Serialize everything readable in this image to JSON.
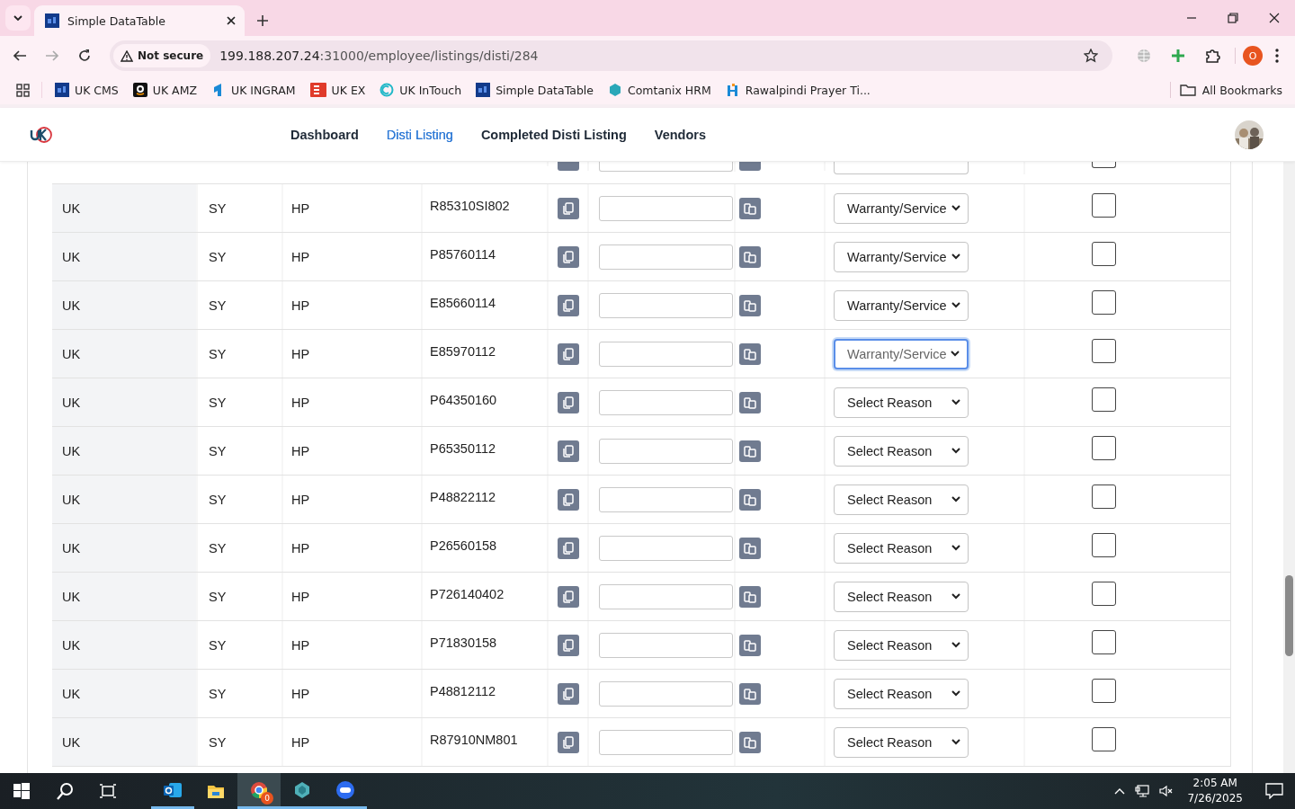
{
  "browser": {
    "tabs": [
      {
        "title": "Simple DataTable",
        "selected": true
      }
    ],
    "address": {
      "security": "Not secure",
      "host": "199.188.207.24",
      "path": ":31000/employee/listings/disti/284"
    },
    "bookmarks": [
      {
        "label": "UK CMS",
        "kind": "df"
      },
      {
        "label": "UK AMZ",
        "kind": "amz"
      },
      {
        "label": "UK INGRAM",
        "kind": "ingram"
      },
      {
        "label": "UK EX",
        "kind": "ex"
      },
      {
        "label": "UK InTouch",
        "kind": "intouch"
      },
      {
        "label": "Simple DataTable",
        "kind": "df"
      },
      {
        "label": "Comtanix HRM",
        "kind": "hex"
      },
      {
        "label": "Rawalpindi Prayer Ti...",
        "kind": "prayer"
      }
    ],
    "all_bookmarks": "All Bookmarks",
    "profile": "O"
  },
  "nav": {
    "items": [
      {
        "label": "Dashboard",
        "selected": false
      },
      {
        "label": "Disti Listing",
        "selected": true
      },
      {
        "label": "Completed Disti Listing",
        "selected": false
      },
      {
        "label": "Vendors",
        "selected": false
      }
    ]
  },
  "table": {
    "partial_row": {
      "checked": false
    },
    "rows": [
      {
        "region": "UK",
        "code": "SY",
        "brand": "HP",
        "part": "R85310SI802",
        "reason": "Warranty/Service",
        "focused": false,
        "checked": false
      },
      {
        "region": "UK",
        "code": "SY",
        "brand": "HP",
        "part": "P85760114",
        "reason": "Warranty/Service",
        "focused": false,
        "checked": false
      },
      {
        "region": "UK",
        "code": "SY",
        "brand": "HP",
        "part": "E85660114",
        "reason": "Warranty/Service",
        "focused": false,
        "checked": false
      },
      {
        "region": "UK",
        "code": "SY",
        "brand": "HP",
        "part": "E85970112",
        "reason": "Warranty/Service",
        "focused": true,
        "checked": false
      },
      {
        "region": "UK",
        "code": "SY",
        "brand": "HP",
        "part": "P64350160",
        "reason": "Select Reason",
        "focused": false,
        "checked": false
      },
      {
        "region": "UK",
        "code": "SY",
        "brand": "HP",
        "part": "P65350112",
        "reason": "Select Reason",
        "focused": false,
        "checked": false
      },
      {
        "region": "UK",
        "code": "SY",
        "brand": "HP",
        "part": "P48822112",
        "reason": "Select Reason",
        "focused": false,
        "checked": false
      },
      {
        "region": "UK",
        "code": "SY",
        "brand": "HP",
        "part": "P26560158",
        "reason": "Select Reason",
        "focused": false,
        "checked": false
      },
      {
        "region": "UK",
        "code": "SY",
        "brand": "HP",
        "part": "P726140402",
        "reason": "Select Reason",
        "focused": false,
        "checked": false
      },
      {
        "region": "UK",
        "code": "SY",
        "brand": "HP",
        "part": "P71830158",
        "reason": "Select Reason",
        "focused": false,
        "checked": false
      },
      {
        "region": "UK",
        "code": "SY",
        "brand": "HP",
        "part": "P48812112",
        "reason": "Select Reason",
        "focused": false,
        "checked": false
      },
      {
        "region": "UK",
        "code": "SY",
        "brand": "HP",
        "part": "R87910NM801",
        "reason": "Select Reason",
        "focused": false,
        "checked": false
      }
    ]
  },
  "taskbar": {
    "chrome_badge": "0",
    "time": "2:05 AM",
    "date": "7/26/2025"
  }
}
